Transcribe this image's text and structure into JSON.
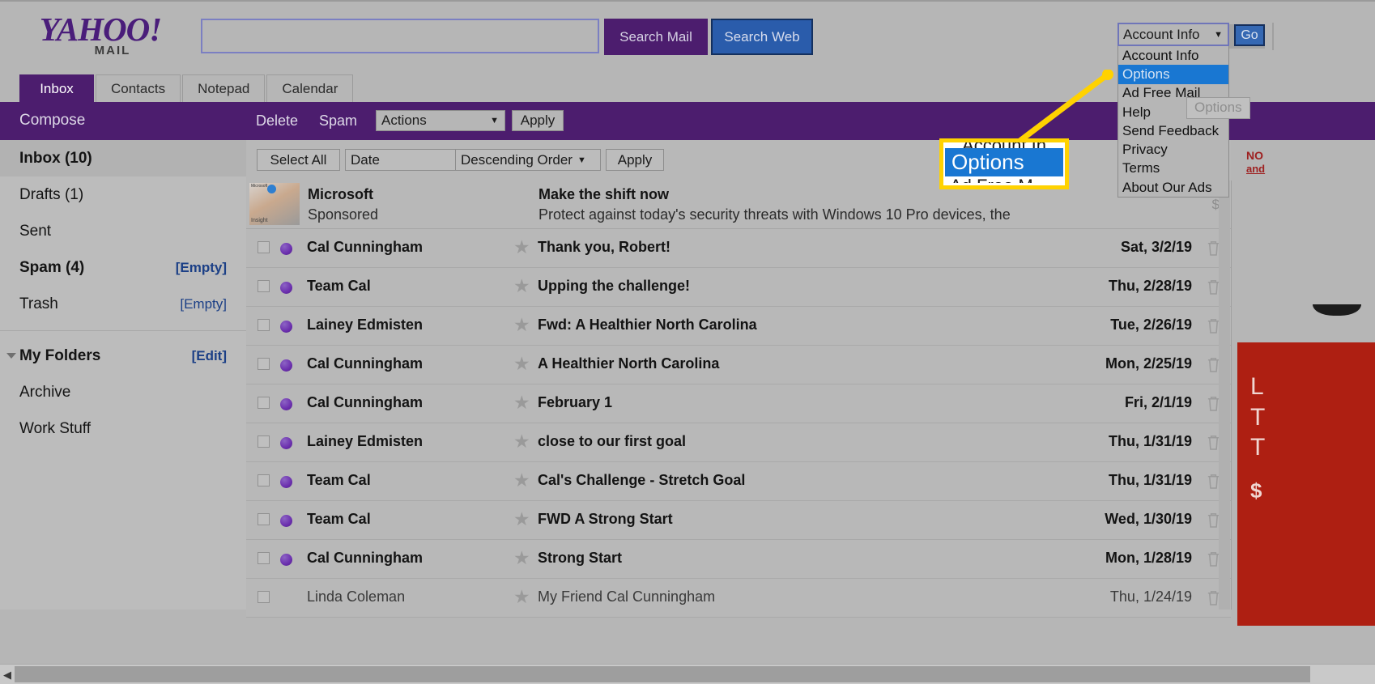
{
  "brand": {
    "name": "YAHOO!",
    "product": "MAIL",
    "logo_color": "#4a1d7a"
  },
  "search": {
    "value": "",
    "placeholder": "",
    "search_mail_label": "Search Mail",
    "search_web_label": "Search Web"
  },
  "account_menu": {
    "selected": "Account Info",
    "caret": "▼",
    "go_label": "Go",
    "tooltip": "Options",
    "items": [
      {
        "label": "Account Info",
        "selected": false
      },
      {
        "label": "Options",
        "selected": true
      },
      {
        "label": "Ad Free Mail",
        "selected": false
      },
      {
        "label": "Help",
        "selected": false
      },
      {
        "label": "Send Feedback",
        "selected": false
      },
      {
        "label": "Privacy",
        "selected": false
      },
      {
        "label": "Terms",
        "selected": false
      },
      {
        "label": "About Our Ads",
        "selected": false
      }
    ]
  },
  "tabs": [
    {
      "label": "Inbox",
      "active": true
    },
    {
      "label": "Contacts",
      "active": false
    },
    {
      "label": "Notepad",
      "active": false
    },
    {
      "label": "Calendar",
      "active": false
    }
  ],
  "action_bar": {
    "compose_label": "Compose",
    "delete_label": "Delete",
    "spam_label": "Spam",
    "actions_select": "Actions",
    "apply_label": "Apply",
    "caret": "▼"
  },
  "list_toolbar": {
    "select_all_label": "Select All",
    "sort_field": "Date",
    "sort_order": "Descending Order",
    "apply_label": "Apply",
    "caret": "▼"
  },
  "sidebar": {
    "folders": [
      {
        "label": "Inbox (10)",
        "action": "",
        "current": true,
        "bold": true
      },
      {
        "label": "Drafts (1)",
        "action": "",
        "current": false,
        "bold": false
      },
      {
        "label": "Sent",
        "action": "",
        "current": false,
        "bold": false
      },
      {
        "label": "Spam (4)",
        "action": "[Empty]",
        "current": false,
        "bold": true
      },
      {
        "label": "Trash",
        "action": "[Empty]",
        "current": false,
        "bold": false
      }
    ],
    "my_folders": {
      "label": "My Folders",
      "action": "[Edit]"
    },
    "custom_folders": [
      {
        "label": "Archive"
      },
      {
        "label": "Work Stuff"
      }
    ]
  },
  "ad_row": {
    "sender": "Microsoft",
    "sponsored": "Sponsored",
    "title": "Make the shift now",
    "description": "Protect against today's security threats with Windows 10 Pro devices, the",
    "thumb_label": "Insight",
    "money_icon": "$"
  },
  "messages": [
    {
      "sender": "Cal Cunningham",
      "subject": "Thank you, Robert!",
      "date": "Sat, 3/2/19",
      "unread": true
    },
    {
      "sender": "Team Cal",
      "subject": "Upping the challenge!",
      "date": "Thu, 2/28/19",
      "unread": true
    },
    {
      "sender": "Lainey Edmisten",
      "subject": "Fwd: A Healthier North Carolina",
      "date": "Tue, 2/26/19",
      "unread": true
    },
    {
      "sender": "Cal Cunningham",
      "subject": "A Healthier North Carolina",
      "date": "Mon, 2/25/19",
      "unread": true
    },
    {
      "sender": "Cal Cunningham",
      "subject": "February 1",
      "date": "Fri, 2/1/19",
      "unread": true
    },
    {
      "sender": "Lainey Edmisten",
      "subject": "close to our first goal",
      "date": "Thu, 1/31/19",
      "unread": true
    },
    {
      "sender": "Team Cal",
      "subject": "Cal's Challenge - Stretch Goal",
      "date": "Thu, 1/31/19",
      "unread": true
    },
    {
      "sender": "Team Cal",
      "subject": "FWD A Strong Start",
      "date": "Wed, 1/30/19",
      "unread": true
    },
    {
      "sender": "Cal Cunningham",
      "subject": "Strong Start",
      "date": "Mon, 1/28/19",
      "unread": true
    },
    {
      "sender": "Linda Coleman",
      "subject": "My Friend Cal Cunningham",
      "date": "Thu, 1/24/19",
      "unread": false
    }
  ],
  "right_ads": {
    "no_heading": "NO",
    "no_sub": "and",
    "promo_line1": "L",
    "promo_line2": "T",
    "promo_line3": "T",
    "promo_price": "$"
  },
  "callout": {
    "above": "Account In",
    "highlight": "Options",
    "below": "Ad Free M",
    "accent_color": "#ffd200",
    "highlight_color": "#1977d2"
  },
  "colors": {
    "purple": "#4c1d6e",
    "blue": "#2a5cab",
    "page_bg": "#b6b6b6",
    "red_ad": "#ae1f12"
  }
}
